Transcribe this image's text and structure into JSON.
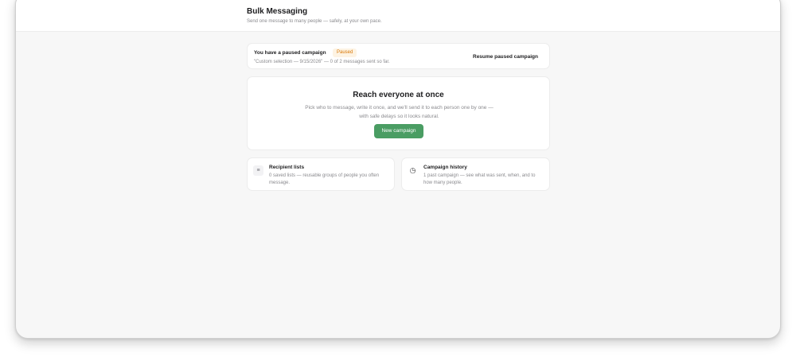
{
  "header": {
    "title": "Bulk Messaging",
    "subtitle": "Send one message to many people — safely, at your own pace."
  },
  "paused_campaign": {
    "title": "You have a paused campaign",
    "badge": "Paused",
    "description": "\"Custom selection — 9/15/2026\" — 0 of 2 messages sent so far.",
    "resume_label": "Resume paused campaign"
  },
  "hero": {
    "title": "Reach everyone at once",
    "description": "Pick who to message, write it once, and we'll send it to each person one by one — with safe delays so it looks natural.",
    "button_label": "New campaign"
  },
  "links": [
    {
      "icon": "list-icon",
      "glyph": "≡",
      "title": "Recipient lists",
      "description": "0 saved lists — reusable groups of people you often message."
    },
    {
      "icon": "clock-icon",
      "glyph": "◷",
      "title": "Campaign history",
      "description": "1 past campaign — see what was sent, when, and to how many people."
    }
  ],
  "colors": {
    "accent": "#4a9d63",
    "paused_badge": "#d97706",
    "background": "#f7f7f7"
  }
}
